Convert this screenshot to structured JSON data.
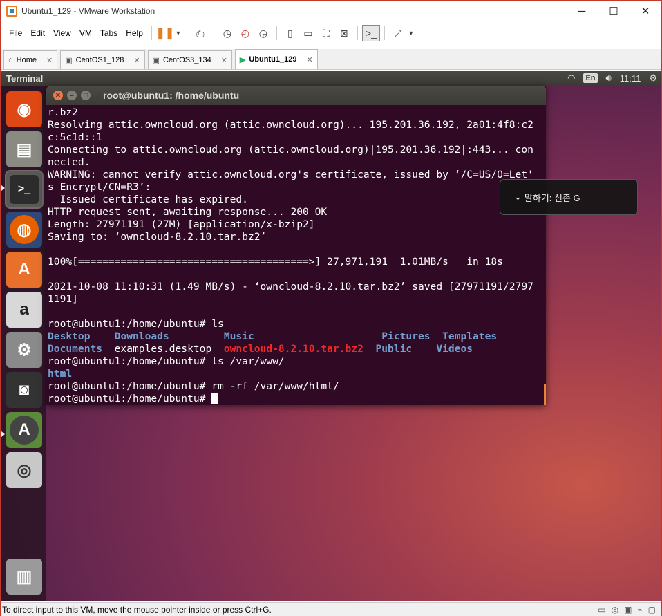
{
  "window": {
    "title": "Ubuntu1_129 - VMware Workstation"
  },
  "window_controls": {
    "minimize": "─",
    "maximize": "☐",
    "close": "✕"
  },
  "menu": [
    "File",
    "Edit",
    "View",
    "VM",
    "Tabs",
    "Help"
  ],
  "toolbar_icons": [
    "pause-icon",
    "dropdown-icon",
    "send-ctrl-alt-del-icon",
    "snapshot-icon",
    "revert-snapshot-icon",
    "snapshot-manager-icon",
    "sidebar-icon",
    "thumbnail-icon",
    "fullscreen-icon",
    "unity-icon",
    "console-icon",
    "stretch-icon",
    "dropdown-icon"
  ],
  "tabs": [
    {
      "label": "Home",
      "icon": "home-icon",
      "active": false
    },
    {
      "label": "CentOS1_128",
      "icon": "vm-icon",
      "active": false
    },
    {
      "label": "CentOS3_134",
      "icon": "vm-icon",
      "active": false
    },
    {
      "label": "Ubuntu1_129",
      "icon": "vm-icon",
      "active": true
    }
  ],
  "panel": {
    "title": "Terminal",
    "lang": "En",
    "time": "11:11"
  },
  "launcher": [
    {
      "name": "ubuntu-dash-icon",
      "glyph": "◉",
      "color": "#dd4814"
    },
    {
      "name": "files-icon",
      "glyph": "▤",
      "color": "#8a8a82"
    },
    {
      "name": "terminal-icon",
      "glyph": ">_",
      "color": "#2c2c2c"
    },
    {
      "name": "firefox-icon",
      "glyph": "◍",
      "color": "#e66000"
    },
    {
      "name": "software-center-icon",
      "glyph": "A",
      "color": "#e8702a"
    },
    {
      "name": "amazon-icon",
      "glyph": "a",
      "color": "#d8d8d8"
    },
    {
      "name": "system-settings-icon",
      "glyph": "⚙",
      "color": "#8a8a8a"
    },
    {
      "name": "safe-icon",
      "glyph": "◙",
      "color": "#333"
    },
    {
      "name": "software-updater-icon",
      "glyph": "A",
      "color": "#5a8a3a"
    },
    {
      "name": "dvd-icon",
      "glyph": "◎",
      "color": "#c8c8c8"
    },
    {
      "name": "trash-icon",
      "glyph": "🗑",
      "color": "#9a9a9a"
    }
  ],
  "terminal": {
    "title": "root@ubuntu1: /home/ubuntu",
    "lines": [
      "r.bz2",
      "Resolving attic.owncloud.org (attic.owncloud.org)... 195.201.36.192, 2a01:4f8:c2",
      "c:5c1d::1",
      "Connecting to attic.owncloud.org (attic.owncloud.org)|195.201.36.192|:443... con",
      "nected.",
      "WARNING: cannot verify attic.owncloud.org's certificate, issued by ‘/C=US/O=Let'",
      "s Encrypt/CN=R3’:",
      "  Issued certificate has expired.",
      "HTTP request sent, awaiting response... 200 OK",
      "Length: 27971191 (27M) [application/x-bzip2]",
      "Saving to: ‘owncloud-8.2.10.tar.bz2’",
      "",
      "100%[======================================>] 27,971,191  1.01MB/s   in 18s",
      "",
      "2021-10-08 11:10:31 (1.49 MB/s) - ‘owncloud-8.2.10.tar.bz2’ saved [27971191/2797",
      "1191]",
      "",
      "root@ubuntu1:/home/ubuntu# ls"
    ],
    "ls_row1": [
      "Desktop    ",
      "Downloads         ",
      "Music                     ",
      "Pictures  ",
      "Templates"
    ],
    "ls_row2_a": "Documents",
    "ls_row2_b": "  examples.desktop  ",
    "ls_row2_c": "owncloud-8.2.10.tar.bz2",
    "ls_row2_d": "  ",
    "ls_row2_e": "Public",
    "ls_row2_f": "    ",
    "ls_row2_g": "Videos",
    "line_ls_www": "root@ubuntu1:/home/ubuntu# ls /var/www/",
    "www_item": "html",
    "line_rm": "root@ubuntu1:/home/ubuntu# rm -rf /var/www/html/",
    "prompt": "root@ubuntu1:/home/ubuntu# "
  },
  "notification": {
    "text": "말하기: 신촌 G"
  },
  "status": {
    "text": "To direct input to this VM, move the mouse pointer inside or press Ctrl+G."
  }
}
